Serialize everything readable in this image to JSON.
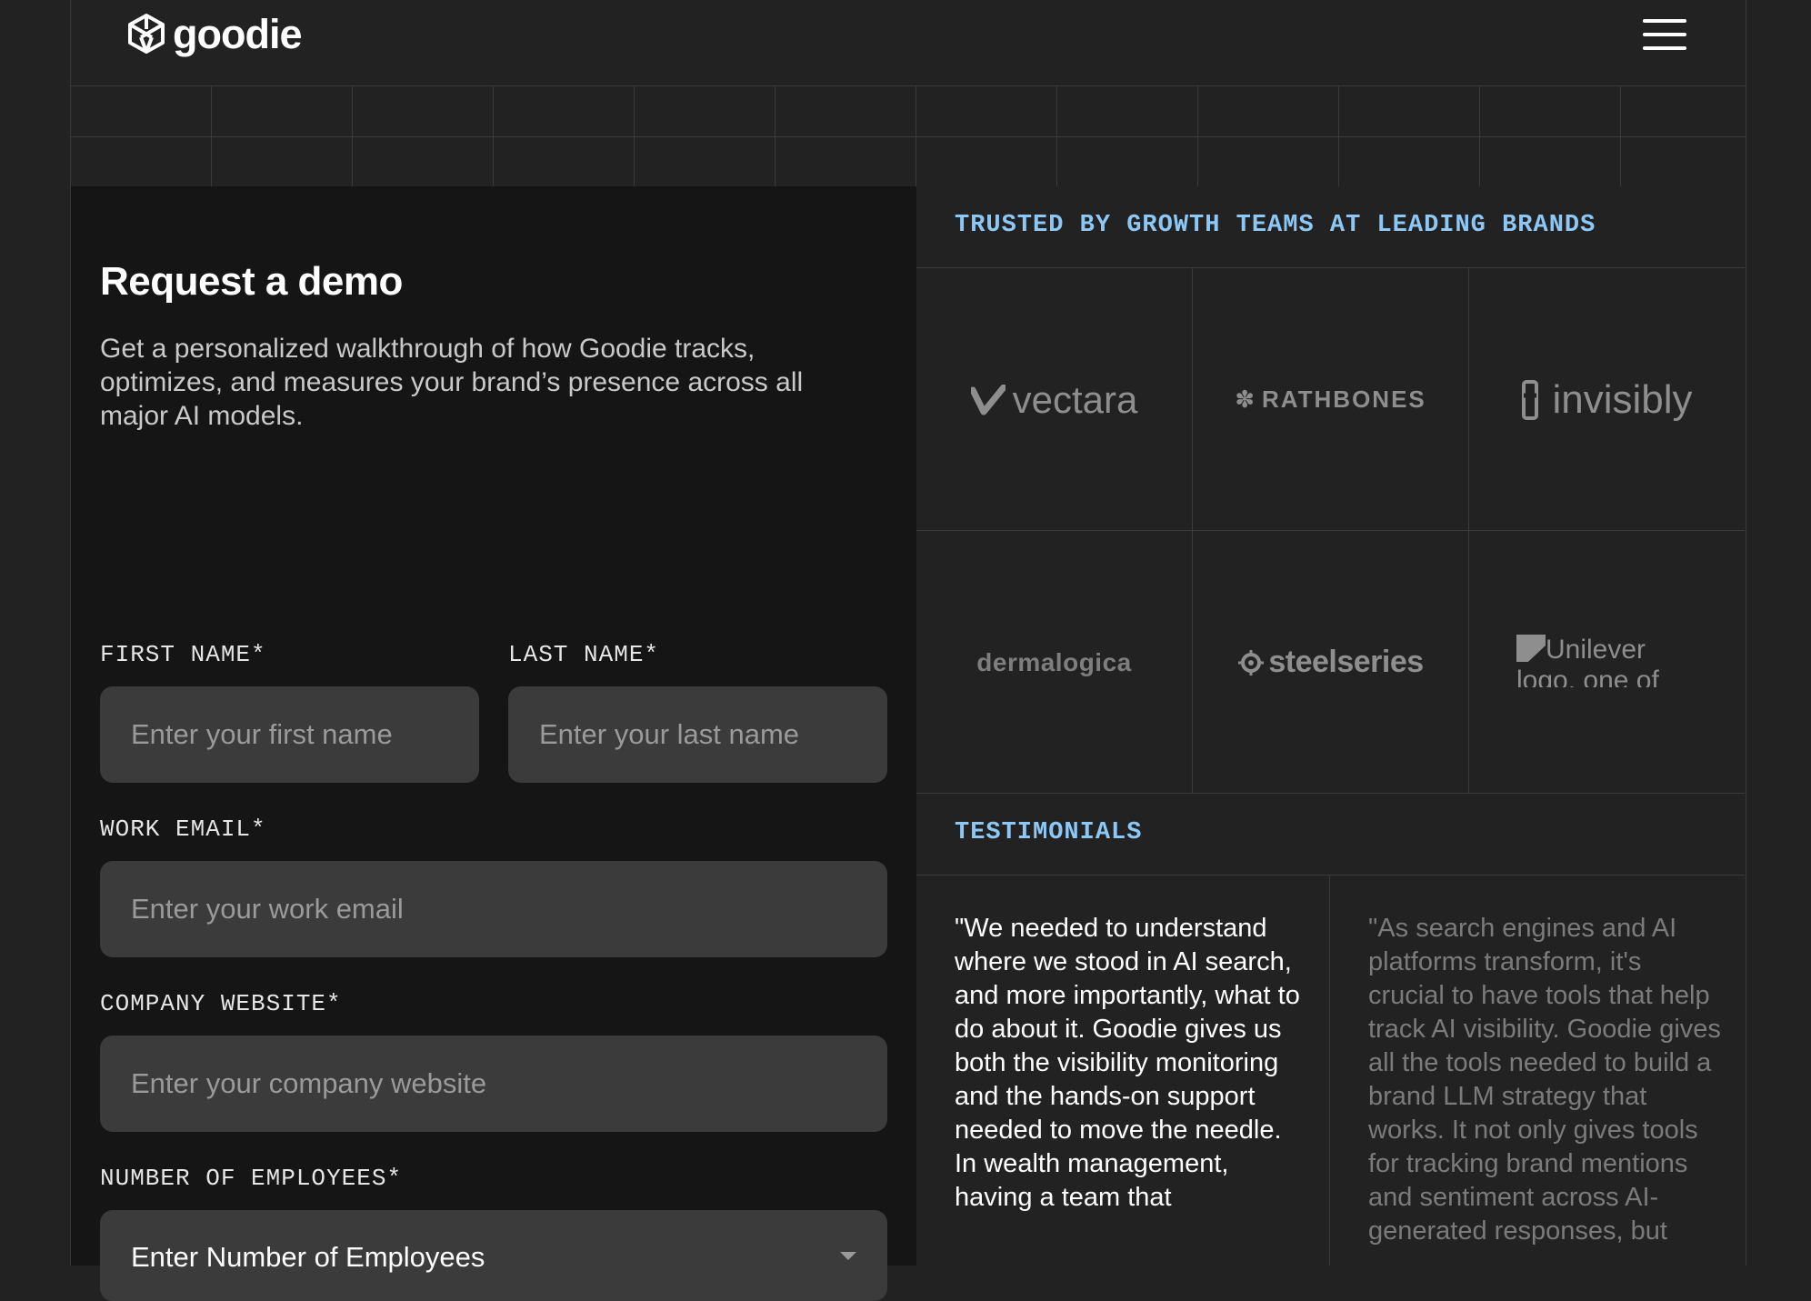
{
  "header": {
    "logo_text": "goodie",
    "logo_icon": "goodie-logo-icon",
    "menu_icon": "hamburger-menu-icon"
  },
  "form": {
    "title": "Request a demo",
    "subtitle": "Get a personalized walkthrough of how Goodie tracks, optimizes, and measures your brand’s presence across all major AI models.",
    "first_name": {
      "label": "FIRST NAME*",
      "placeholder": "Enter your first name"
    },
    "last_name": {
      "label": "LAST NAME*",
      "placeholder": "Enter your last name"
    },
    "work_email": {
      "label": "WORK EMAIL*",
      "placeholder": "Enter your work email"
    },
    "company_website": {
      "label": "COMPANY WEBSITE*",
      "placeholder": "Enter your company website"
    },
    "employees": {
      "label": "NUMBER OF EMPLOYEES*",
      "placeholder": "Enter Number of Employees"
    }
  },
  "trusted": {
    "heading": "TRUSTED BY GROWTH TEAMS AT LEADING BRANDS",
    "brands": [
      "vectara",
      "RATHBONES",
      "invisibly",
      "dermalogica",
      "steelseries",
      "Unilever logo, one of"
    ]
  },
  "testimonials": {
    "heading": "TESTIMONIALS",
    "items": [
      "\"We needed to understand where we stood in AI search, and more importantly, what to do about it. Goodie gives us both the visibility monitoring and the hands-on support needed to move the needle. In wealth management, having a team that",
      "\"As search engines and AI platforms transform, it's crucial to have tools that help track AI visibility. Goodie gives all the tools needed to build a brand LLM strategy that works. It not only gives tools for tracking brand mentions and sentiment across AI-generated responses, but"
    ]
  },
  "colors": {
    "background": "#222222",
    "form_panel": "#151515",
    "input_bg": "#3b3b3b",
    "accent_heading": "#8cc7f5"
  }
}
